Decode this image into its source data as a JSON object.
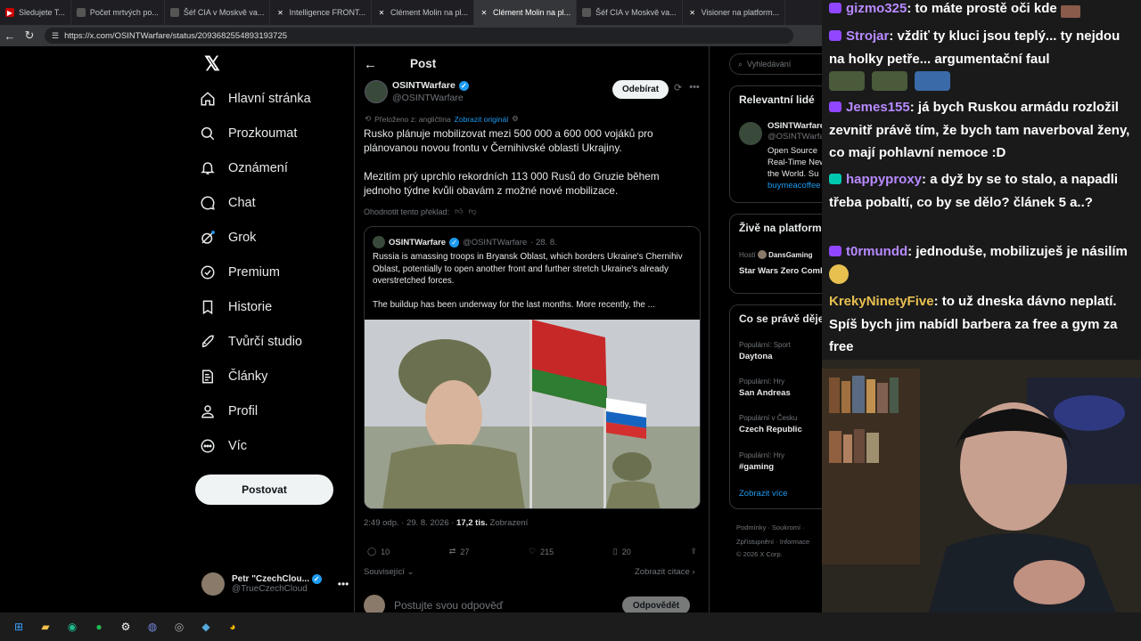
{
  "browser": {
    "tabs": [
      {
        "label": "Sledujete T...",
        "icon": "yt-icon"
      },
      {
        "label": "Počet mrtvých po...",
        "icon": "page-icon"
      },
      {
        "label": "Šéf CIA v Moskvě va...",
        "icon": "page-icon"
      },
      {
        "label": "Intelligence FRONT...",
        "icon": "x-icon"
      },
      {
        "label": "Clément Molin na pl...",
        "icon": "x-icon"
      },
      {
        "label": "Clément Molin na pl...",
        "icon": "x-icon",
        "active": true
      },
      {
        "label": "Šéf CIA v Moskvě va...",
        "icon": "page-icon"
      },
      {
        "label": "Visioner na platform...",
        "icon": "x-icon"
      }
    ],
    "url": "https://x.com/OSINTWarfare/status/2093682554893193725"
  },
  "nav": {
    "items": [
      {
        "label": "Hlavní stránka",
        "icon": "home-icon"
      },
      {
        "label": "Prozkoumat",
        "icon": "search-icon"
      },
      {
        "label": "Oznámení",
        "icon": "bell-icon"
      },
      {
        "label": "Chat",
        "icon": "chat-icon"
      },
      {
        "label": "Grok",
        "icon": "grok-icon"
      },
      {
        "label": "Premium",
        "icon": "premium-icon"
      },
      {
        "label": "Historie",
        "icon": "bookmark-icon"
      },
      {
        "label": "Tvůrčí studio",
        "icon": "rocket-icon"
      },
      {
        "label": "Články",
        "icon": "article-icon"
      },
      {
        "label": "Profil",
        "icon": "person-icon"
      },
      {
        "label": "Víc",
        "icon": "more-icon"
      }
    ],
    "post_label": "Postovat",
    "account": {
      "name": "Petr \"CzechClou...",
      "handle": "@TrueCzechCloud"
    }
  },
  "post": {
    "header": "Post",
    "author": {
      "name": "OSINTWarfare",
      "handle": "@OSINTWarfare"
    },
    "follow_label": "Odebírat",
    "translated_label": "Přeloženo z: angličtina",
    "show_original": "Zobrazit originál",
    "text": "Rusko plánuje mobilizovat mezi 500 000 a 600 000 vojáků pro plánovanou novou frontu v Černihivské oblasti Ukrajiny.\n\nMezitím prý uprchlo rekordních 113 000 Rusů do Gruzie během jednoho týdne kvůli obavám z možné nové mobilizace.",
    "rate_label": "Ohodnotit tento překlad:",
    "quote": {
      "name": "OSINTWarfare",
      "handle": "@OSINTWarfare",
      "date": "· 28. 8.",
      "text": "Russia is amassing troops in Bryansk Oblast, which borders Ukraine's Chernihiv Oblast, potentially to open another front and further stretch Ukraine's already overstretched forces.\n\nThe buildup has been underway for the last months. More recently, the ..."
    },
    "time": "2:49 odp. · 29. 8. 2026 · ",
    "views": "17,2 tis.",
    "views_label": "Zobrazení",
    "actions": {
      "replies": "10",
      "reposts": "27",
      "likes": "215",
      "bookmarks": "20"
    },
    "related_label": "Související",
    "show_quotes": "Zobrazit citace",
    "reply_placeholder": "Postujte svou odpověď",
    "reply_button": "Odpovědět"
  },
  "sidebar": {
    "search_placeholder": "Vyhledávání",
    "relevant_title": "Relevantní lidé",
    "person": {
      "name": "OSINTWarfare",
      "handle": "@OSINTWarfare",
      "bio": "Open Source\nReal-Time News\nthe World. Su",
      "link": "buymeacoffee"
    },
    "live_title": "Živě na platformě",
    "live_host_label": "Hostí",
    "live_host": "DansGaming",
    "live_title_text": "Star Wars Zero Combat",
    "trends_title": "Co se právě děje",
    "trends": [
      {
        "category": "Populární: Sport",
        "name": "Daytona"
      },
      {
        "category": "Populární: Hry",
        "name": "San Andreas"
      },
      {
        "category": "Populární v Česku",
        "name": "Czech Republic"
      },
      {
        "category": "Populární: Hry",
        "name": "#gaming"
      }
    ],
    "show_more": "Zobrazit více",
    "footer": [
      "Podmínky · Soukromí ·",
      "Zpřístupnění · Informace",
      "© 2026 X Corp."
    ]
  },
  "chat": {
    "messages": [
      {
        "user": "gizmo325",
        "color": "#b88aff",
        "text": ": to máte prostě oči kde"
      },
      {
        "user": "Strojar",
        "color": "#b88aff",
        "text": ": vždiť ty kluci jsou teplý... ty nejdou na holky petře... argumentační faul"
      },
      {
        "user": "Jemes155",
        "color": "#b88aff",
        "text": ": já bych Ruskou armádu rozložil zevnitř právě tím, že bych tam naverboval ženy, co mají pohlavní nemoce :D"
      },
      {
        "user": "happyproxy",
        "color": "#b88aff",
        "text": ": a dyž by se to stalo, a napadli třeba pobaltí, co by se dělo? článek 5 a..?"
      },
      {
        "user": "t0rmundd",
        "color": "#b88aff",
        "text": ": jednoduše, mobilizuješ je násilím"
      },
      {
        "user": "KrekyNinetyFive",
        "color": "#e8c050",
        "text": ": to už dneska dávno neplatí. Spíš bych jim nabídl barbera za free a gym za free"
      }
    ]
  }
}
